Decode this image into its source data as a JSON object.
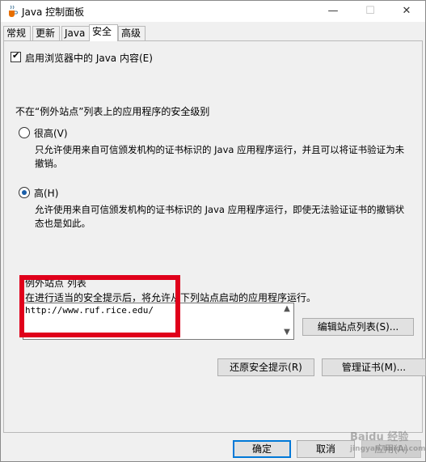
{
  "window": {
    "title": "Java 控制面板",
    "controls": {
      "minimize": "—",
      "maximize": "☐",
      "close": "✕"
    }
  },
  "tabs": [
    {
      "label": "常规",
      "active": false
    },
    {
      "label": "更新",
      "active": false
    },
    {
      "label": "Java",
      "active": false
    },
    {
      "label": "安全",
      "active": true
    },
    {
      "label": "高级",
      "active": false
    }
  ],
  "security": {
    "enable_browser_java": {
      "label": "启用浏览器中的 Java 内容(E)",
      "checked": true
    },
    "level_heading": "不在“例外站点”列表上的应用程序的安全级别",
    "levels": [
      {
        "label": "很高(V)",
        "selected": false,
        "description": "只允许使用来自可信颁发机构的证书标识的 Java 应用程序运行，并且可以将证书验证为未撤销。"
      },
      {
        "label": "高(H)",
        "selected": true,
        "description": "允许使用来自可信颁发机构的证书标识的 Java 应用程序运行，即使无法验证证书的撤销状态也是如此。"
      }
    ],
    "exception_list": {
      "title": "例外站点 列表",
      "description": "在进行适当的安全提示后，将允许从下列站点启动的应用程序运行。",
      "sites": [
        "http://www.ruf.rice.edu/"
      ],
      "edit_button": "编辑站点列表(S)..."
    },
    "restore_prompts_button": "还原安全提示(R)",
    "manage_certs_button": "管理证书(M)..."
  },
  "footer": {
    "ok_button": "确定",
    "cancel_button": "取消",
    "apply_button": "应用(A)"
  },
  "annotation": {
    "color": "#e0001b"
  },
  "watermark": {
    "line1": "Baidu 经验",
    "line2": "jingyan.baidu.com"
  }
}
